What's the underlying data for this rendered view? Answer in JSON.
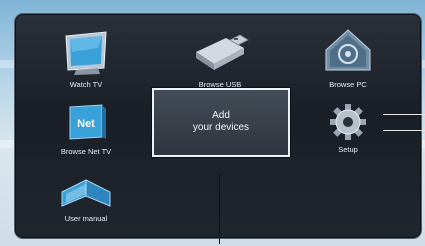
{
  "home_menu": {
    "items": [
      {
        "label": "Watch TV",
        "icon": "tv-icon"
      },
      {
        "label": "Browse USB",
        "icon": "usb-drive-icon"
      },
      {
        "label": "Browse PC",
        "icon": "network-pc-icon"
      },
      {
        "label": "Browse Net TV",
        "icon": "net-tv-icon"
      },
      {
        "label": "Setup",
        "icon": "gear-icon"
      },
      {
        "label": "User manual",
        "icon": "book-icon"
      }
    ],
    "add_devices": {
      "line1": "Add",
      "line2": "your devices"
    }
  },
  "net_tv_badge": "Net",
  "colors": {
    "frame_bg": "#1f252d",
    "icon_blue": "#3aa0d8",
    "icon_gray": "#9aa3ad",
    "text": "#e6edf4"
  }
}
